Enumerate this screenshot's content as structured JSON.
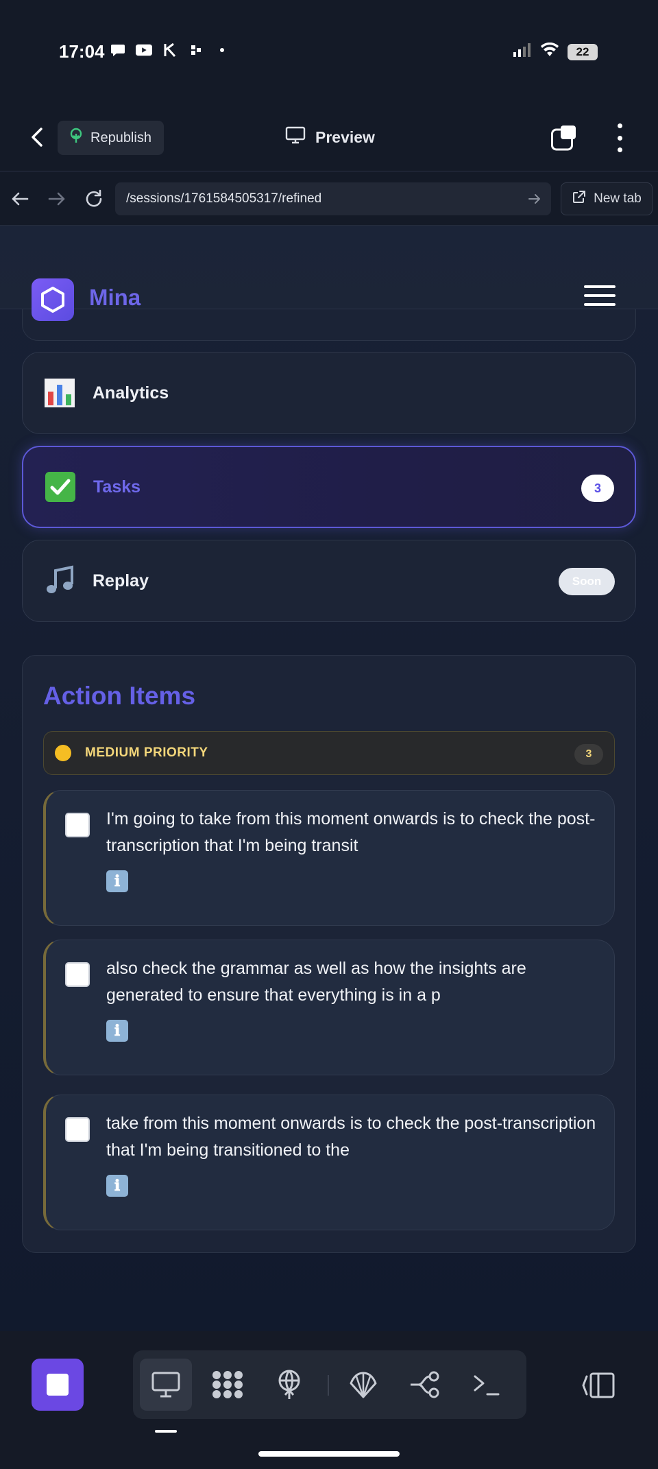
{
  "status_bar": {
    "time": "17:04",
    "battery": "22"
  },
  "app_header": {
    "republish_label": "Republish",
    "preview_label": "Preview"
  },
  "browser": {
    "url": "/sessions/1761584505317/refined",
    "new_tab_label": "New tab"
  },
  "site": {
    "brand": "Mina"
  },
  "nav_cards": [
    {
      "label": "Analytics",
      "icon": "bar-chart-emoji"
    },
    {
      "label": "Tasks",
      "icon": "check-mark-emoji",
      "badge": "3",
      "active": true
    },
    {
      "label": "Replay",
      "icon": "music-note-emoji",
      "badge": "Soon"
    }
  ],
  "action_items": {
    "title": "Action Items",
    "priority": {
      "label": "MEDIUM PRIORITY",
      "count": "3",
      "color": "#f5bd23"
    },
    "tasks": [
      {
        "text": "I'm going to take from this moment onwards is to check the post-transcription that I'm being transit",
        "info_icon": "ℹ"
      },
      {
        "text": "also check the grammar as well as how the insights are generated to ensure that everything is in a p",
        "info_icon": "ℹ"
      },
      {
        "text": "take from this moment onwards is to check the post-transcription that I'm being transitioned to the",
        "info_icon": "ℹ"
      }
    ]
  },
  "colors": {
    "accent": "#6560e6",
    "stop_button": "#6b48e3",
    "priority": "#f5bd23"
  },
  "toolbar": {
    "tools": [
      "desktop-icon",
      "dots-grid-icon",
      "antenna-icon",
      "shell-icon",
      "branch-icon",
      "terminal-icon"
    ]
  }
}
